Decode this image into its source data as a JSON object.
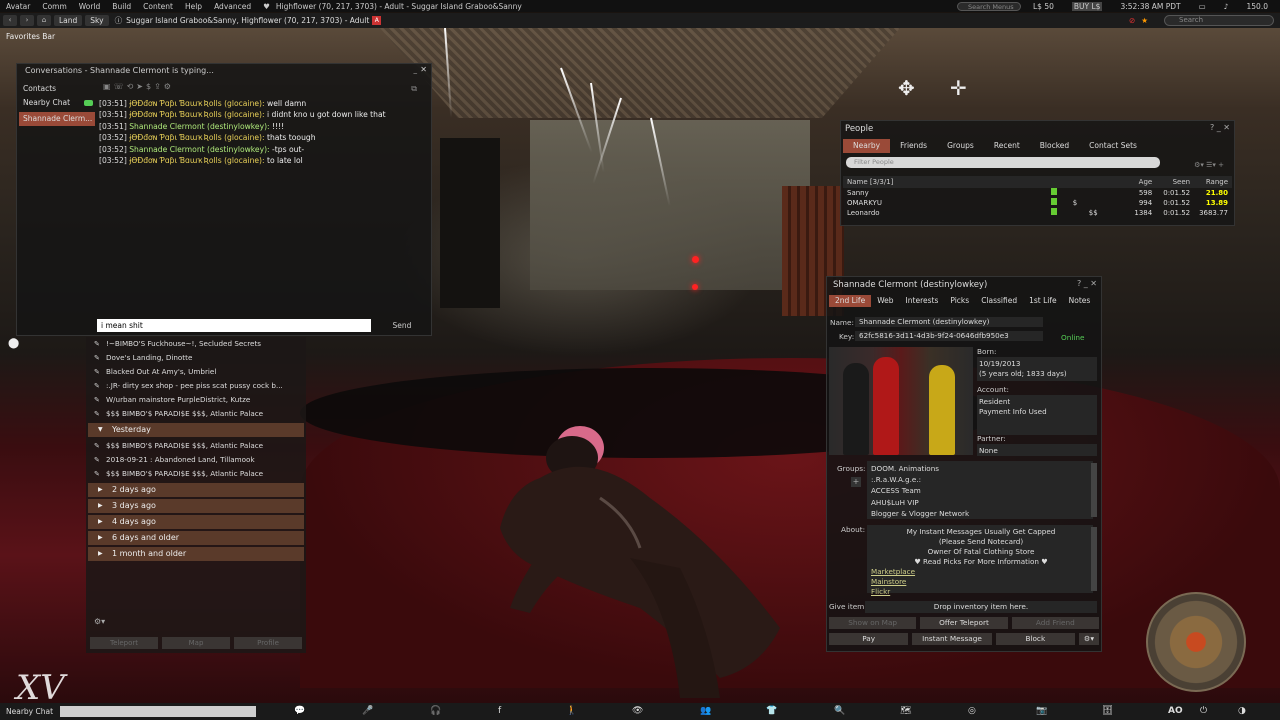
{
  "menubar": {
    "items": [
      "Avatar",
      "Comm",
      "World",
      "Build",
      "Content",
      "Help",
      "Advanced"
    ],
    "title": "Highflower (70, 217, 3703) - Adult - Suggar Island Graboo&Sanny",
    "search_placeholder": "Search Menus",
    "balance": "L$ 50",
    "buy": "BUY L$",
    "time": "3:52:38 AM PDT",
    "fps": "150.0"
  },
  "navbar": {
    "land": "Land",
    "sky": "Sky",
    "location": "Suggar Island Graboo&Sanny, Highflower (70, 217, 3703) - Adult",
    "rating_badge": "A",
    "search_placeholder": "Search"
  },
  "favorites": "Favorites Bar",
  "conversations": {
    "title": "Conversations - Shannade Clermont is typing...",
    "contacts_label": "Contacts",
    "side_items": [
      {
        "label": "Nearby Chat"
      },
      {
        "label": "Shannade Clerm..."
      }
    ],
    "messages": [
      {
        "time": "[03:51]",
        "name": "ɉƟƉđơɴ Ƥɑƥɩ ƁɑɯҡƦolls (glocaine):",
        "text": "well damn",
        "who": "n1"
      },
      {
        "time": "[03:51]",
        "name": "ɉƟƉđơɴ Ƥɑƥɩ ƁɑɯҡƦolls (glocaine):",
        "text": "i didnt kno u got down like that",
        "who": "n1"
      },
      {
        "time": "[03:51]",
        "name": "Shannade Clermont (destinylowkey):",
        "text": "!!!!",
        "who": "n2"
      },
      {
        "time": "[03:52]",
        "name": "ɉƟƉđơɴ Ƥɑƥɩ ƁɑɯҡƦolls (glocaine):",
        "text": "thats toough",
        "who": "n1"
      },
      {
        "time": "[03:52]",
        "name": "Shannade Clermont (destinylowkey):",
        "text": "-tps out-",
        "who": "n2"
      },
      {
        "time": "[03:52]",
        "name": "ɉƟƉđơɴ Ƥɑƥɩ ƁɑɯҡƦolls (glocaine):",
        "text": "to late lol",
        "who": "n1"
      }
    ],
    "input_value": "i mean shit",
    "send_label": "Send"
  },
  "teleport_history": {
    "today": [
      "!~BIMBO'S Fuckhouse~!, Secluded Secrets",
      "Dove's Landing, Dinotte",
      "Blacked Out At Amy's, Umbriel",
      ":.JR- dirty sex shop - pee piss scat pussy cock b...",
      "W/urban mainstore PurpleDistrict, Kutze",
      "$$$ BIMBO'$ PARADI$E $$$, Atlantic Palace"
    ],
    "yesterday_label": "Yesterday",
    "yesterday": [
      "$$$ BIMBO'$ PARADI$E $$$, Atlantic Palace",
      "2018-09-21 : Abandoned Land, Tillamook",
      "$$$ BIMBO'$ PARADI$E $$$, Atlantic Palace"
    ],
    "groups": [
      "2 days ago",
      "3 days ago",
      "4 days ago",
      "6 days and older",
      "1 month and older"
    ],
    "buttons": [
      "Teleport",
      "Map",
      "Profile"
    ]
  },
  "people": {
    "title": "People",
    "tabs": [
      "Nearby",
      "Friends",
      "Groups",
      "Recent",
      "Blocked",
      "Contact Sets"
    ],
    "filter_placeholder": "Filter People",
    "columns": {
      "name": "Name [3/3/1]",
      "age": "Age",
      "seen": "Seen",
      "range": "Range"
    },
    "rows": [
      {
        "name": "Sanny",
        "age": "598",
        "seen": "0:01.52",
        "range": "21.80",
        "hl": true,
        "extra": ""
      },
      {
        "name": "OMARKYU",
        "age": "994",
        "seen": "0:01.52",
        "range": "13.89",
        "hl": true,
        "extra": "$"
      },
      {
        "name": "Leonardo",
        "age": "1384",
        "seen": "0:01.52",
        "range": "3683.77",
        "hl": false,
        "extra": "$$"
      }
    ]
  },
  "profile": {
    "title": "Shannade Clermont (destinylowkey)",
    "tabs": [
      "2nd Life",
      "Web",
      "Interests",
      "Picks",
      "Classified",
      "1st Life",
      "Notes"
    ],
    "name_label": "Name:",
    "name_value": "Shannade Clermont (destinylowkey)",
    "key_label": "Key:",
    "key_value": "62fc5816-3d11-4d3b-9f24-0646dfb950e3",
    "status": "Online",
    "born_label": "Born:",
    "born_date": "10/19/2013",
    "born_age": "(5 years old; 1833 days)",
    "account_label": "Account:",
    "account_type": "Resident",
    "payment": "Payment Info Used",
    "partner_label": "Partner:",
    "partner_value": "None",
    "groups_label": "Groups:",
    "groups": [
      "DOOM. Animations",
      ":.R.a.W.A.g.e.:",
      "ACCESS Team",
      "AHU$LuH VIP",
      "Blogger & Vlogger Network"
    ],
    "about_label": "About:",
    "about_lines": [
      "My Instant Messages Usually Get Capped",
      "(Please Send Notecard)",
      "Owner Of Fatal Clothing Store",
      "♥ Read Picks For More Information ♥"
    ],
    "links": [
      "Marketplace",
      "Mainstore",
      "Flickr"
    ],
    "give_label": "Give item:",
    "drop_text": "Drop inventory item here.",
    "row1": [
      "Show on Map",
      "Offer Teleport",
      "Add Friend"
    ],
    "row2": [
      "Pay",
      "Instant Message",
      "Block"
    ]
  },
  "bottombar": {
    "nearby_chat": "Nearby Chat",
    "ao": "AO"
  },
  "watermark": "XV"
}
